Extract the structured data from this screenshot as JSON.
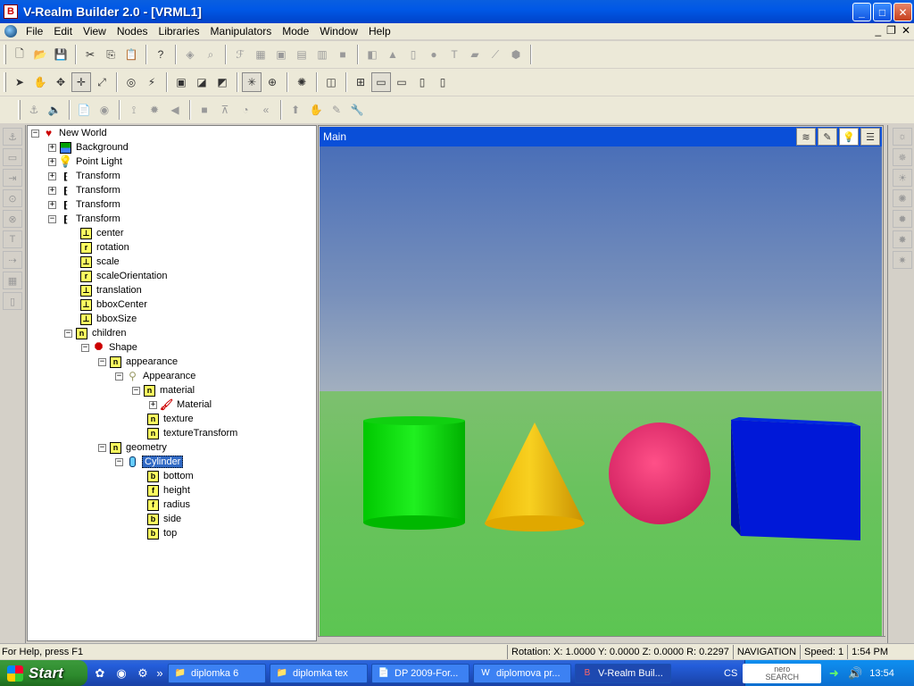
{
  "window": {
    "title": "V-Realm Builder 2.0 - [VRML1]",
    "app_icon_letter": "B"
  },
  "window_buttons": {
    "minimize": "_",
    "maximize": "□",
    "close": "✕"
  },
  "menu": {
    "items": [
      "File",
      "Edit",
      "View",
      "Nodes",
      "Libraries",
      "Manipulators",
      "Mode",
      "Window",
      "Help"
    ],
    "mdi": {
      "minimize": "_",
      "restore": "❐",
      "close": "✕"
    }
  },
  "tree": {
    "root": "New World",
    "nodes": {
      "background": "Background",
      "point_light": "Point Light",
      "transform1": "Transform",
      "transform2": "Transform",
      "transform3": "Transform",
      "transform4": "Transform",
      "center": "center",
      "rotation": "rotation",
      "scale": "scale",
      "scaleOrientation": "scaleOrientation",
      "translation": "translation",
      "bboxCenter": "bboxCenter",
      "bboxSize": "bboxSize",
      "children": "children",
      "shape": "Shape",
      "appearance_field": "appearance",
      "appearance_node": "Appearance",
      "material_field": "material",
      "material_node": "Material",
      "texture": "texture",
      "textureTransform": "textureTransform",
      "geometry": "geometry",
      "cylinder": "Cylinder",
      "bottom": "bottom",
      "height": "height",
      "radius": "radius",
      "side": "side",
      "top": "top"
    },
    "field_icons": {
      "sf3": "⊥",
      "rot": "r",
      "node": "n",
      "bool": "b",
      "float": "f"
    },
    "expanders": {
      "plus": "+",
      "minus": "−"
    }
  },
  "viewport": {
    "title": "Main",
    "sky_top_color": "#4a6fb8",
    "ground_color": "#5cc552",
    "objects": {
      "cylinder_color": "#00e000",
      "cone_color": "#f0c000",
      "sphere_color": "#f03070",
      "box_color": "#0018d8"
    }
  },
  "status": {
    "help": "For Help, press F1",
    "rotation": "Rotation: X: 1.0000  Y: 0.0000  Z: 0.0000  R: 0.2297",
    "mode": "NAVIGATION",
    "speed": "Speed: 1",
    "time": "1:54 PM"
  },
  "taskbar": {
    "start": "Start",
    "tasks": [
      "diplomka 6",
      "diplomka tex",
      "DP 2009-For...",
      "diplomova pr...",
      "V-Realm Buil..."
    ],
    "tray_label": "CS",
    "nero_line1": "nero",
    "nero_line2": "SEARCH",
    "clock": "13:54"
  }
}
